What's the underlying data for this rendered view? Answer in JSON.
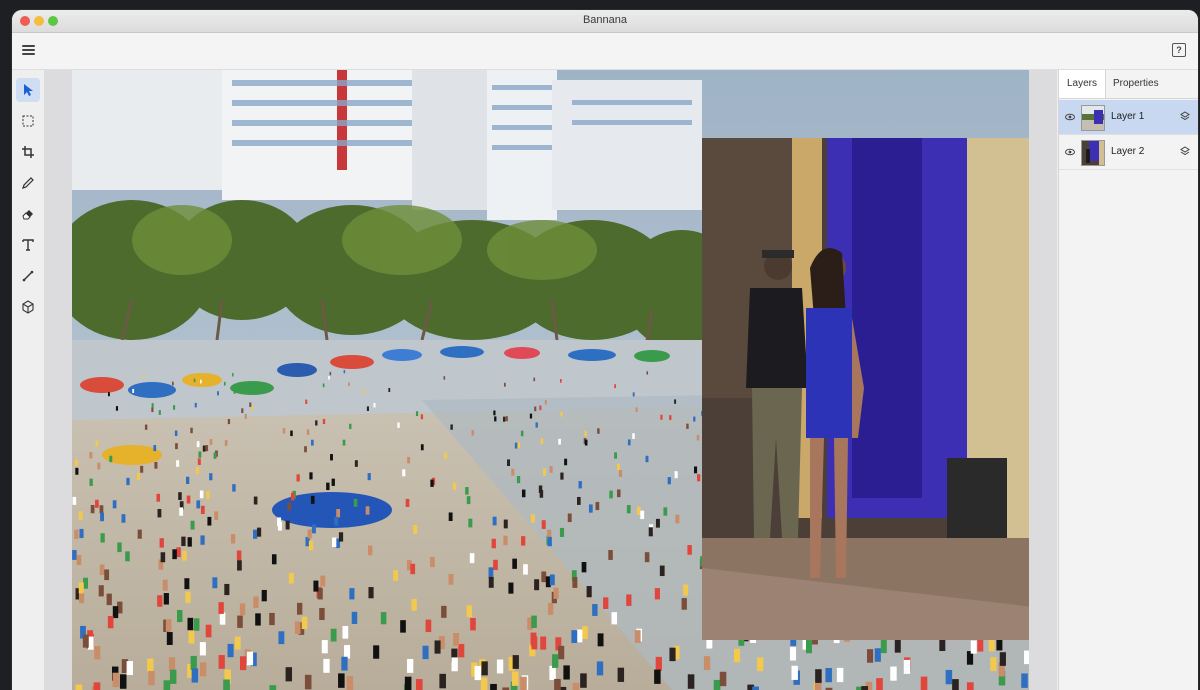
{
  "app": {
    "title": "Bannana"
  },
  "menubar": {
    "menu_icon": "hamburger-menu-icon",
    "help_icon": "help-icon"
  },
  "tools": [
    {
      "name": "select-tool",
      "icon": "arrow-pointer-icon",
      "active": true
    },
    {
      "name": "marquee-tool",
      "icon": "dashed-rectangle-icon",
      "active": false
    },
    {
      "name": "crop-tool",
      "icon": "crop-icon",
      "active": false
    },
    {
      "name": "pencil-tool",
      "icon": "pencil-icon",
      "active": false
    },
    {
      "name": "eraser-tool",
      "icon": "eraser-icon",
      "active": false
    },
    {
      "name": "text-tool",
      "icon": "text-icon",
      "active": false
    },
    {
      "name": "line-tool",
      "icon": "line-icon",
      "active": false
    },
    {
      "name": "3d-tool",
      "icon": "cube-icon",
      "active": false
    }
  ],
  "panel": {
    "tabs": {
      "layers": "Layers",
      "properties": "Properties"
    },
    "layers": [
      {
        "name": "Layer 1",
        "selected": true,
        "visible": true
      },
      {
        "name": "Layer 2",
        "selected": false,
        "visible": true
      }
    ]
  },
  "colors": {
    "accent": "#c7d8f0",
    "selected_tool": "#d0def3"
  }
}
